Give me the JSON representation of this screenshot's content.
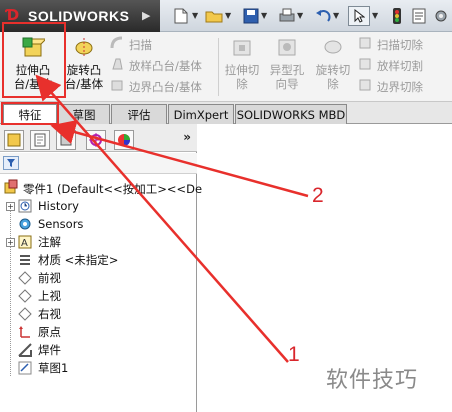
{
  "app": {
    "brand": "SOLIDWORKS"
  },
  "ribbon": {
    "extrude_boss": "拉伸凸\n台/基体",
    "revolve_boss": "旋转凸\n台/基体",
    "sweep": "扫描",
    "loft": "放样凸台/基体",
    "boundary": "边界凸台/基体",
    "extrude_cut": "拉伸切\n除",
    "hole_wizard": "异型孔\n向导",
    "revolve_cut": "旋转切\n除",
    "swept_cut": "扫描切除",
    "lofted_cut": "放样切割",
    "boundary_cut": "边界切除"
  },
  "tabs": [
    "特征",
    "草图",
    "评估",
    "DimXpert",
    "SOLIDWORKS MBD"
  ],
  "active_tab": "特征",
  "panel": {
    "expand_symbol": "»",
    "root": "零件1 (Default<<按加工><<De",
    "items": [
      {
        "label": "History",
        "icon": "history-icon",
        "expandable": true
      },
      {
        "label": "Sensors",
        "icon": "sensors-icon",
        "expandable": false
      },
      {
        "label": "注解",
        "icon": "annotations-icon",
        "expandable": true
      },
      {
        "label": "材质 <未指定>",
        "icon": "material-icon",
        "expandable": false
      },
      {
        "label": "前视",
        "icon": "plane-icon",
        "expandable": false
      },
      {
        "label": "上视",
        "icon": "plane-icon",
        "expandable": false
      },
      {
        "label": "右视",
        "icon": "plane-icon",
        "expandable": false
      },
      {
        "label": "原点",
        "icon": "origin-icon",
        "expandable": false
      },
      {
        "label": "焊件",
        "icon": "weldment-icon",
        "expandable": false
      },
      {
        "label": "草图1",
        "icon": "sketch-icon",
        "expandable": false
      }
    ]
  },
  "annotations": {
    "label_1": "1",
    "label_2": "2",
    "accent": "#e8302c"
  },
  "watermark": {
    "text": "软件技巧"
  }
}
